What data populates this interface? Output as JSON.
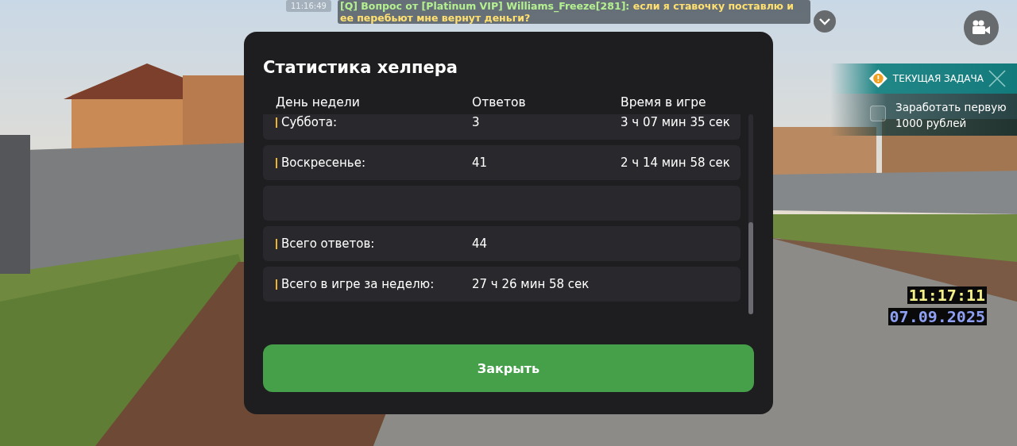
{
  "chat": [
    {
      "time": "11:16:49",
      "author": "[Q] Вопрос от [Platinum VIP] Williams_Freeze[281]:",
      "text": "если я ставочку поставлю и ее перебьют мне вернут деньги?"
    }
  ],
  "task_panel": {
    "title": "ТЕКУЩАЯ ЗАДАЧА",
    "tasks": [
      {
        "label": "Заработать первую 1000 рублей",
        "checked": false
      }
    ]
  },
  "clock": {
    "time": "11:17:11",
    "date": "07.09.2025"
  },
  "dialog": {
    "title": "Статистика хелпера",
    "table": {
      "columns": [
        "День недели",
        "Ответов",
        "Время в игре"
      ],
      "rows": [
        {
          "kind": "day",
          "cells": [
            "Суббота:",
            "3",
            "3 ч 07 мин 35 сек"
          ]
        },
        {
          "kind": "day",
          "cells": [
            "Воскресенье:",
            "41",
            "2 ч 14 мин 58 сек"
          ]
        },
        {
          "kind": "empty",
          "cells": []
        },
        {
          "kind": "total",
          "cells": [
            "Всего ответов:",
            "44"
          ]
        },
        {
          "kind": "total",
          "cells": [
            "Всего в игре за неделю:",
            "27 ч 26 мин 58 сек"
          ]
        }
      ]
    },
    "button": "Закрыть"
  }
}
